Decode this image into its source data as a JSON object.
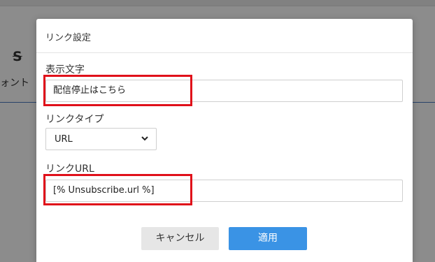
{
  "background": {
    "font_label": "ォント"
  },
  "dialog": {
    "title": "リンク設定",
    "display_text": {
      "label": "表示文字",
      "value": "配信停止はこちら"
    },
    "link_type": {
      "label": "リンクタイプ",
      "selected": "URL"
    },
    "link_url": {
      "label": "リンクURL",
      "value": "[% Unsubscribe.url %]"
    },
    "buttons": {
      "cancel": "キャンセル",
      "apply": "適用"
    },
    "colors": {
      "highlight": "#e0101a",
      "apply_button": "#3a93e5",
      "cancel_button": "#e6e6e6"
    }
  }
}
